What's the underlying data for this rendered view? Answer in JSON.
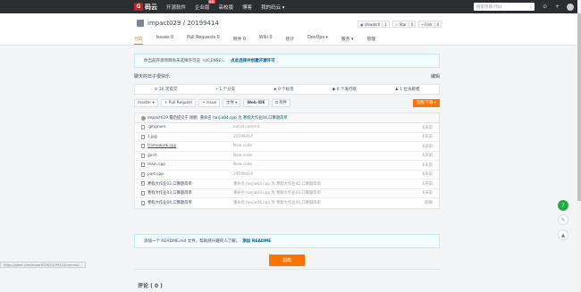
{
  "topnav": {
    "logo_text": "码云",
    "links": [
      "开源软件",
      "企业版",
      "高校版",
      "博客",
      "我的码云 ▾"
    ],
    "hot_badge": "特惠",
    "search_placeholder": "搜索项目/代码",
    "plus": "+",
    "bell": "⊙"
  },
  "repo": {
    "title": "impact029 / 20199414",
    "watch_label": "Unwatch",
    "watch_count": "1",
    "star_label": "Star",
    "star_count": "0",
    "fork_label": "Fork",
    "fork_count": "0"
  },
  "tabs": [
    "代码",
    "Issues 0",
    "Pull Requests 0",
    "附件 0",
    "Wiki 0",
    "统计",
    "DevOps ▾",
    "服务 ▾",
    "管理"
  ],
  "notice": {
    "text": "你当前开源项目尚未选择许可证（LICENSE），",
    "link": "点此选择并创建开源许可"
  },
  "description": {
    "text": "聊天的日子很快乐",
    "edit": "编辑"
  },
  "stats": [
    "16 次提交",
    "1 个分支",
    "0 个标签",
    "0 个发行版",
    "1 位贡献者"
  ],
  "toolbar": {
    "branch": "master ▾",
    "pull_request": "+ Pull Request",
    "issue": "+ Issue",
    "file": "文件 ▾",
    "webide": "Web IDE",
    "attachment": "附件",
    "clone": "克隆/下载 ▾"
  },
  "commit": {
    "author": "impact029",
    "action": "最后提交于 刚刚",
    "message": "重命名 harjia04.cpp 为 寒假大作业04,口算题简单"
  },
  "files": [
    {
      "name": ".gitignore",
      "msg": "Initial commit",
      "time": "6天前"
    },
    {
      "name": "1.jpg",
      "msg": "20199414",
      "time": "6天前"
    },
    {
      "name": "framework.cpp",
      "msg": "New code",
      "time": "6天前"
    },
    {
      "name": "gui.h",
      "msg": "New code",
      "time": "6天前"
    },
    {
      "name": "main.cpp",
      "msg": "New code",
      "time": "6天前"
    },
    {
      "name": "part.cpp",
      "msg": "20199414",
      "time": "6天前"
    },
    {
      "name": "寒假大作业02,口算题简单",
      "msg": "重命名 harjia02.cpp 为 寒假大作业02,口算题简单",
      "time": "6天前"
    },
    {
      "name": "寒假大作业03,口算题简单",
      "msg": "重命名 harjia03.cpp 为 寒假大作业03,口算题简单",
      "time": "6天前"
    },
    {
      "name": "寒假大作业04,口算题简单",
      "msg": "重命名 harjia04.cpp 为 寒假大作业04,口算题简单",
      "time": "刚刚"
    }
  ],
  "readme": {
    "text": "添加一个 README.md 文件，帮助感兴趣的人了解。",
    "link": "添加 README"
  },
  "donate": "捐赠",
  "comments": "评论 ( 0 )",
  "status_url": "https://gitee.com/impact029/20199414/commit/...",
  "fabs": {
    "help": "?",
    "chat": "✎",
    "top": "▲"
  }
}
